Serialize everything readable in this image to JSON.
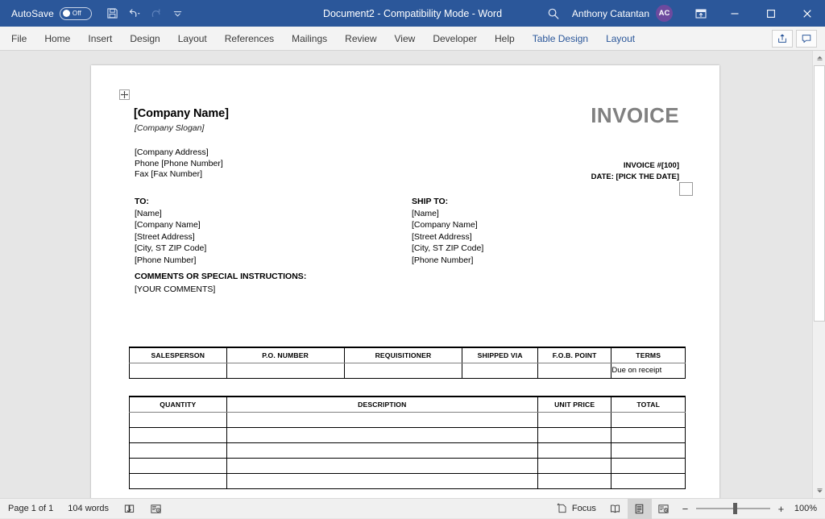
{
  "titlebar": {
    "autosave_label": "AutoSave",
    "autosave_state": "Off",
    "document_title": "Document2  -  Compatibility Mode  -  Word",
    "user_name": "Anthony Catantan",
    "user_initials": "AC",
    "accent_color": "#2b579a",
    "avatar_color": "#6d4a9e",
    "quick_access": [
      {
        "name": "save-icon",
        "label": "Save"
      },
      {
        "name": "undo-icon",
        "label": "Undo"
      },
      {
        "name": "redo-icon",
        "label": "Redo"
      },
      {
        "name": "customize-quick-access-icon",
        "label": "Customize Quick Access Toolbar"
      }
    ],
    "window_buttons": [
      {
        "name": "minimize-button",
        "glyph": "—"
      },
      {
        "name": "maximize-button",
        "glyph": "☐"
      },
      {
        "name": "close-button",
        "glyph": "✕"
      }
    ]
  },
  "ribbon": {
    "tabs": [
      {
        "label": "File",
        "contextual": false
      },
      {
        "label": "Home",
        "contextual": false
      },
      {
        "label": "Insert",
        "contextual": false
      },
      {
        "label": "Design",
        "contextual": false
      },
      {
        "label": "Layout",
        "contextual": false
      },
      {
        "label": "References",
        "contextual": false
      },
      {
        "label": "Mailings",
        "contextual": false
      },
      {
        "label": "Review",
        "contextual": false
      },
      {
        "label": "View",
        "contextual": false
      },
      {
        "label": "Developer",
        "contextual": false
      },
      {
        "label": "Help",
        "contextual": false
      },
      {
        "label": "Table Design",
        "contextual": true
      },
      {
        "label": "Layout",
        "contextual": true
      }
    ],
    "contextual_color": "#2b579a",
    "right_buttons": [
      {
        "name": "share-icon",
        "label": "Share"
      },
      {
        "name": "comments-icon",
        "label": "Comments"
      }
    ]
  },
  "document": {
    "company_name": "[Company Name]",
    "company_slogan": "[Company Slogan]",
    "company_address": "[Company Address]",
    "company_phone": "Phone [Phone Number]",
    "company_fax": "Fax [Fax Number]",
    "invoice_title": "INVOICE",
    "invoice_title_color": "#808080",
    "invoice_number": "INVOICE #[100]",
    "invoice_date": "DATE: [PICK THE DATE]",
    "to": {
      "heading": "TO:",
      "lines": [
        "[Name]",
        "[Company Name]",
        "[Street Address]",
        "[City, ST ZIP Code]",
        "[Phone Number]"
      ]
    },
    "ship_to": {
      "heading": "SHIP TO:",
      "lines": [
        "[Name]",
        "[Company Name]",
        "[Street Address]",
        "[City, ST ZIP Code]",
        "[Phone Number]"
      ]
    },
    "comments": {
      "heading": "COMMENTS OR SPECIAL INSTRUCTIONS:",
      "body": "[YOUR COMMENTS]"
    },
    "order_table": {
      "headers": [
        "SALESPERSON",
        "P.O. NUMBER",
        "REQUISITIONER",
        "SHIPPED VIA",
        "F.O.B. POINT",
        "TERMS"
      ],
      "rows": [
        [
          "",
          "",
          "",
          "",
          "",
          "Due on receipt"
        ]
      ]
    },
    "items_table": {
      "headers": [
        "QUANTITY",
        "DESCRIPTION",
        "UNIT PRICE",
        "TOTAL"
      ],
      "rows": [
        [
          "",
          "",
          "",
          ""
        ],
        [
          "",
          "",
          "",
          ""
        ],
        [
          "",
          "",
          "",
          ""
        ],
        [
          "",
          "",
          "",
          ""
        ],
        [
          "",
          "",
          "",
          ""
        ]
      ]
    }
  },
  "statusbar": {
    "page_status": "Page 1 of 1",
    "word_count": "104 words",
    "proofing_icon": "spelling-check-icon",
    "language_icon": "accessibility-icon",
    "focus_label": "Focus",
    "views": [
      {
        "name": "read-mode-view-button",
        "active": false
      },
      {
        "name": "print-layout-view-button",
        "active": true
      },
      {
        "name": "web-layout-view-button",
        "active": false
      }
    ],
    "zoom_out_label": "−",
    "zoom_in_label": "+",
    "zoom_level": "100%"
  }
}
